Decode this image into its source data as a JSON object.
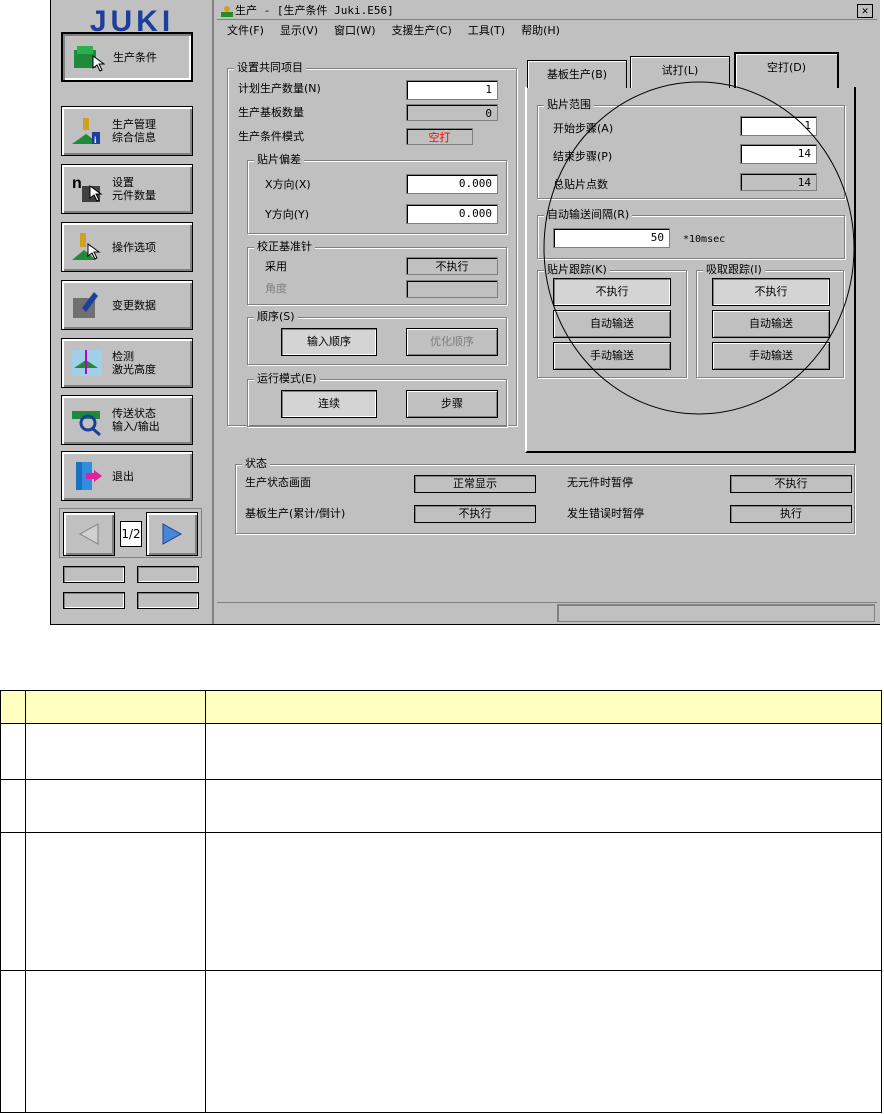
{
  "sidebar": {
    "logo": "JUKI",
    "buttons": [
      {
        "label": "生产条件",
        "icon": "production-condition-icon",
        "active": true
      },
      {
        "label": "生产管理\n综合信息",
        "icon": "production-info-icon",
        "active": false
      },
      {
        "label": "设置\n元件数量",
        "icon": "component-count-icon",
        "active": false
      },
      {
        "label": "操作选项",
        "icon": "operation-option-icon",
        "active": false
      },
      {
        "label": "变更数据",
        "icon": "edit-data-icon",
        "active": false
      },
      {
        "label": "检测\n激光高度",
        "icon": "laser-height-icon",
        "active": false
      },
      {
        "label": "传送状态\n输入/输出",
        "icon": "transfer-io-icon",
        "active": false
      },
      {
        "label": "退出",
        "icon": "exit-door-icon",
        "active": false
      }
    ],
    "pager": {
      "prev_icon": "prev-arrow-icon",
      "page": "1/2",
      "next_icon": "next-arrow-icon"
    }
  },
  "window": {
    "title": "生产 - [生产条件 Juki.E56]",
    "close": "✕",
    "menu": [
      "文件(F)",
      "显示(V)",
      "窗口(W)",
      "支援生产(C)",
      "工具(T)",
      "帮助(H)"
    ]
  },
  "common": {
    "title": "设置共同项目",
    "plan_qty_label": "计划生产数量(N)",
    "plan_qty": "1",
    "board_qty_label": "生产基板数量",
    "board_qty": "0",
    "mode_label": "生产条件模式",
    "mode": "空打",
    "offset": {
      "title": "贴片偏差",
      "x_label": "X方向(X)",
      "x": "0.000",
      "y_label": "Y方向(Y)",
      "y": "0.000"
    },
    "pin": {
      "title": "校正基准针",
      "use_label": "采用",
      "use": "不执行",
      "angle_label": "角度",
      "angle": ""
    },
    "order": {
      "title": "顺序(S)",
      "input": "输入顺序",
      "optimize": "优化顺序"
    },
    "run": {
      "title": "运行模式(E)",
      "continuous": "连续",
      "step": "步骤"
    }
  },
  "tabs": [
    "基板生产(B)",
    "试打(L)",
    "空打(D)"
  ],
  "dry": {
    "range": {
      "title": "贴片范围",
      "start_label": "开始步骤(A)",
      "start": "1",
      "end_label": "结束步骤(P)",
      "end": "14",
      "total_label": "总贴片点数",
      "total": "14"
    },
    "interval": {
      "title": "自动输送间隔(R)",
      "value": "50",
      "unit": "*10msec"
    },
    "trace": {
      "title": "贴片跟踪(K)",
      "options": [
        "不执行",
        "自动输送",
        "手动输送"
      ]
    },
    "pick": {
      "title": "吸取跟踪(I)",
      "options": [
        "不执行",
        "自动输送",
        "手动输送"
      ]
    }
  },
  "status": {
    "title": "状态",
    "rows": [
      {
        "l1": "生产状态画面",
        "v1": "正常显示",
        "l2": "无元件时暂停",
        "v2": "不执行"
      },
      {
        "l1": "基板生产(累计/倒计)",
        "v1": "不执行",
        "l2": "发生错误时暂停",
        "v2": "执行"
      }
    ]
  },
  "colors": {
    "background": "#c0c0c0",
    "logo": "#1a3f9c",
    "mode_text": "#ff0000",
    "table_header": "#ffffc0"
  }
}
